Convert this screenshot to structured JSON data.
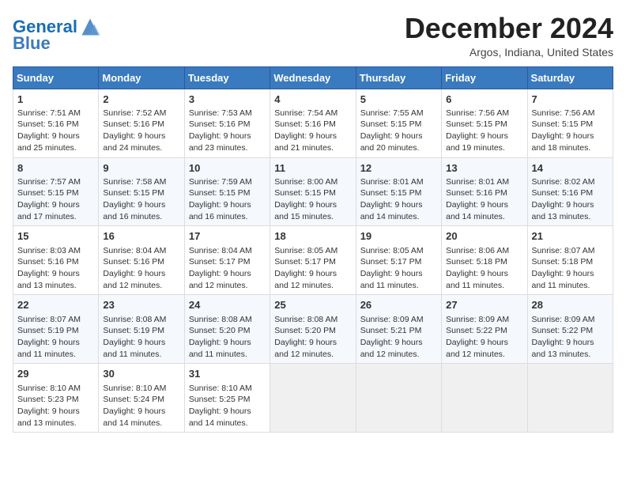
{
  "logo": {
    "line1": "General",
    "line2": "Blue"
  },
  "title": "December 2024",
  "location": "Argos, Indiana, United States",
  "days_header": [
    "Sunday",
    "Monday",
    "Tuesday",
    "Wednesday",
    "Thursday",
    "Friday",
    "Saturday"
  ],
  "weeks": [
    [
      {
        "day": "1",
        "sunrise": "Sunrise: 7:51 AM",
        "sunset": "Sunset: 5:16 PM",
        "daylight": "Daylight: 9 hours and 25 minutes."
      },
      {
        "day": "2",
        "sunrise": "Sunrise: 7:52 AM",
        "sunset": "Sunset: 5:16 PM",
        "daylight": "Daylight: 9 hours and 24 minutes."
      },
      {
        "day": "3",
        "sunrise": "Sunrise: 7:53 AM",
        "sunset": "Sunset: 5:16 PM",
        "daylight": "Daylight: 9 hours and 23 minutes."
      },
      {
        "day": "4",
        "sunrise": "Sunrise: 7:54 AM",
        "sunset": "Sunset: 5:16 PM",
        "daylight": "Daylight: 9 hours and 21 minutes."
      },
      {
        "day": "5",
        "sunrise": "Sunrise: 7:55 AM",
        "sunset": "Sunset: 5:15 PM",
        "daylight": "Daylight: 9 hours and 20 minutes."
      },
      {
        "day": "6",
        "sunrise": "Sunrise: 7:56 AM",
        "sunset": "Sunset: 5:15 PM",
        "daylight": "Daylight: 9 hours and 19 minutes."
      },
      {
        "day": "7",
        "sunrise": "Sunrise: 7:56 AM",
        "sunset": "Sunset: 5:15 PM",
        "daylight": "Daylight: 9 hours and 18 minutes."
      }
    ],
    [
      {
        "day": "8",
        "sunrise": "Sunrise: 7:57 AM",
        "sunset": "Sunset: 5:15 PM",
        "daylight": "Daylight: 9 hours and 17 minutes."
      },
      {
        "day": "9",
        "sunrise": "Sunrise: 7:58 AM",
        "sunset": "Sunset: 5:15 PM",
        "daylight": "Daylight: 9 hours and 16 minutes."
      },
      {
        "day": "10",
        "sunrise": "Sunrise: 7:59 AM",
        "sunset": "Sunset: 5:15 PM",
        "daylight": "Daylight: 9 hours and 16 minutes."
      },
      {
        "day": "11",
        "sunrise": "Sunrise: 8:00 AM",
        "sunset": "Sunset: 5:15 PM",
        "daylight": "Daylight: 9 hours and 15 minutes."
      },
      {
        "day": "12",
        "sunrise": "Sunrise: 8:01 AM",
        "sunset": "Sunset: 5:15 PM",
        "daylight": "Daylight: 9 hours and 14 minutes."
      },
      {
        "day": "13",
        "sunrise": "Sunrise: 8:01 AM",
        "sunset": "Sunset: 5:16 PM",
        "daylight": "Daylight: 9 hours and 14 minutes."
      },
      {
        "day": "14",
        "sunrise": "Sunrise: 8:02 AM",
        "sunset": "Sunset: 5:16 PM",
        "daylight": "Daylight: 9 hours and 13 minutes."
      }
    ],
    [
      {
        "day": "15",
        "sunrise": "Sunrise: 8:03 AM",
        "sunset": "Sunset: 5:16 PM",
        "daylight": "Daylight: 9 hours and 13 minutes."
      },
      {
        "day": "16",
        "sunrise": "Sunrise: 8:04 AM",
        "sunset": "Sunset: 5:16 PM",
        "daylight": "Daylight: 9 hours and 12 minutes."
      },
      {
        "day": "17",
        "sunrise": "Sunrise: 8:04 AM",
        "sunset": "Sunset: 5:17 PM",
        "daylight": "Daylight: 9 hours and 12 minutes."
      },
      {
        "day": "18",
        "sunrise": "Sunrise: 8:05 AM",
        "sunset": "Sunset: 5:17 PM",
        "daylight": "Daylight: 9 hours and 12 minutes."
      },
      {
        "day": "19",
        "sunrise": "Sunrise: 8:05 AM",
        "sunset": "Sunset: 5:17 PM",
        "daylight": "Daylight: 9 hours and 11 minutes."
      },
      {
        "day": "20",
        "sunrise": "Sunrise: 8:06 AM",
        "sunset": "Sunset: 5:18 PM",
        "daylight": "Daylight: 9 hours and 11 minutes."
      },
      {
        "day": "21",
        "sunrise": "Sunrise: 8:07 AM",
        "sunset": "Sunset: 5:18 PM",
        "daylight": "Daylight: 9 hours and 11 minutes."
      }
    ],
    [
      {
        "day": "22",
        "sunrise": "Sunrise: 8:07 AM",
        "sunset": "Sunset: 5:19 PM",
        "daylight": "Daylight: 9 hours and 11 minutes."
      },
      {
        "day": "23",
        "sunrise": "Sunrise: 8:08 AM",
        "sunset": "Sunset: 5:19 PM",
        "daylight": "Daylight: 9 hours and 11 minutes."
      },
      {
        "day": "24",
        "sunrise": "Sunrise: 8:08 AM",
        "sunset": "Sunset: 5:20 PM",
        "daylight": "Daylight: 9 hours and 11 minutes."
      },
      {
        "day": "25",
        "sunrise": "Sunrise: 8:08 AM",
        "sunset": "Sunset: 5:20 PM",
        "daylight": "Daylight: 9 hours and 12 minutes."
      },
      {
        "day": "26",
        "sunrise": "Sunrise: 8:09 AM",
        "sunset": "Sunset: 5:21 PM",
        "daylight": "Daylight: 9 hours and 12 minutes."
      },
      {
        "day": "27",
        "sunrise": "Sunrise: 8:09 AM",
        "sunset": "Sunset: 5:22 PM",
        "daylight": "Daylight: 9 hours and 12 minutes."
      },
      {
        "day": "28",
        "sunrise": "Sunrise: 8:09 AM",
        "sunset": "Sunset: 5:22 PM",
        "daylight": "Daylight: 9 hours and 13 minutes."
      }
    ],
    [
      {
        "day": "29",
        "sunrise": "Sunrise: 8:10 AM",
        "sunset": "Sunset: 5:23 PM",
        "daylight": "Daylight: 9 hours and 13 minutes."
      },
      {
        "day": "30",
        "sunrise": "Sunrise: 8:10 AM",
        "sunset": "Sunset: 5:24 PM",
        "daylight": "Daylight: 9 hours and 14 minutes."
      },
      {
        "day": "31",
        "sunrise": "Sunrise: 8:10 AM",
        "sunset": "Sunset: 5:25 PM",
        "daylight": "Daylight: 9 hours and 14 minutes."
      },
      {
        "day": "",
        "sunrise": "",
        "sunset": "",
        "daylight": ""
      },
      {
        "day": "",
        "sunrise": "",
        "sunset": "",
        "daylight": ""
      },
      {
        "day": "",
        "sunrise": "",
        "sunset": "",
        "daylight": ""
      },
      {
        "day": "",
        "sunrise": "",
        "sunset": "",
        "daylight": ""
      }
    ]
  ]
}
